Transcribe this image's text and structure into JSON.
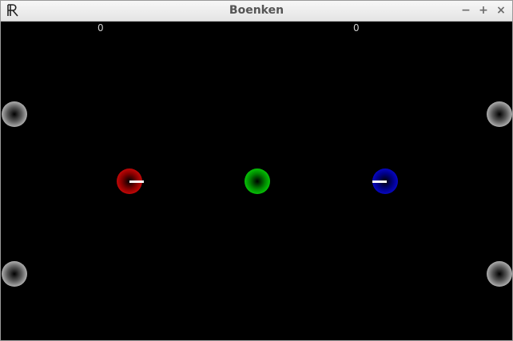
{
  "window": {
    "title": "Boenken",
    "app_icon": "boenken-logo-icon",
    "controls": {
      "minimize": "−",
      "maximize": "+",
      "close": "×"
    }
  },
  "game": {
    "scores": {
      "left": "0",
      "right": "0"
    },
    "balls": [
      {
        "name": "red-ball",
        "color": "#ff1010"
      },
      {
        "name": "green-ball",
        "color": "#10ff10"
      },
      {
        "name": "blue-ball",
        "color": "#1010ff"
      }
    ],
    "bumpers": [
      "top-left",
      "bottom-left",
      "top-right",
      "bottom-right"
    ],
    "background": "#000000"
  }
}
